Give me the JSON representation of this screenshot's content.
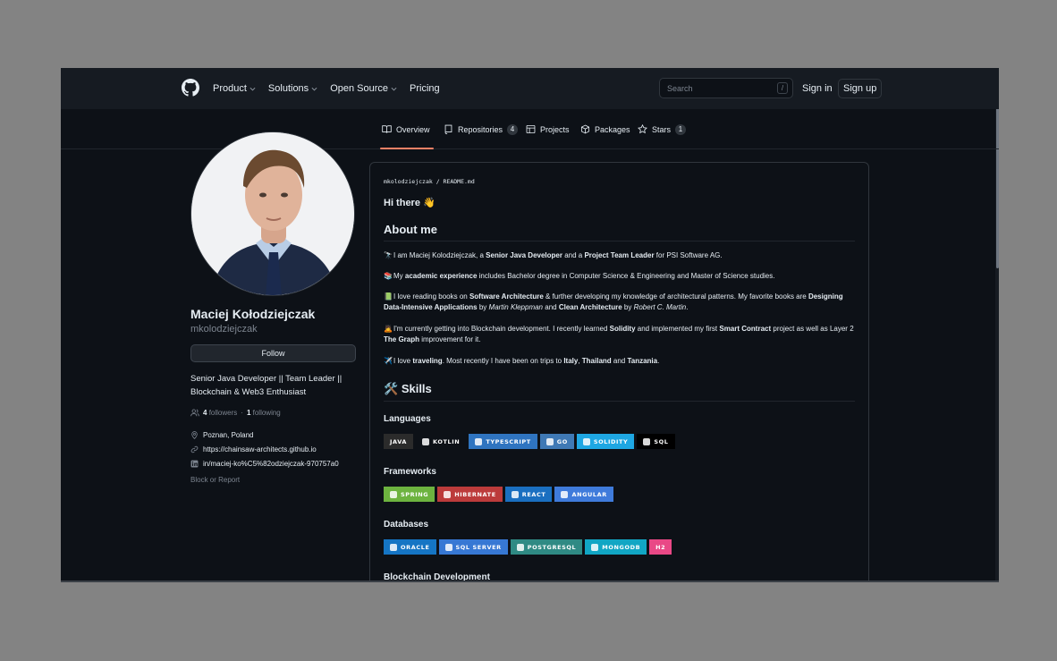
{
  "header": {
    "nav": [
      {
        "label": "Product",
        "has_caret": true
      },
      {
        "label": "Solutions",
        "has_caret": true
      },
      {
        "label": "Open Source",
        "has_caret": true
      },
      {
        "label": "Pricing",
        "has_caret": false
      }
    ],
    "search_placeholder": "Search",
    "search_shortcut": "/",
    "sign_in": "Sign in",
    "sign_up": "Sign up"
  },
  "tabs": [
    {
      "label": "Overview",
      "icon": "book-icon",
      "count": null,
      "active": true
    },
    {
      "label": "Repositories",
      "icon": "repo-icon",
      "count": "4",
      "active": false
    },
    {
      "label": "Projects",
      "icon": "table-icon",
      "count": null,
      "active": false
    },
    {
      "label": "Packages",
      "icon": "package-icon",
      "count": null,
      "active": false
    },
    {
      "label": "Stars",
      "icon": "star-icon",
      "count": "1",
      "active": false
    }
  ],
  "profile": {
    "name": "Maciej Kołodziejczak",
    "username": "mkolodziejczak",
    "follow_label": "Follow",
    "bio": "Senior Java Developer || Team Leader || Blockchain & Web3 Enthusiast",
    "followers_count": "4",
    "followers_label": "followers",
    "separator": "·",
    "following_count": "1",
    "following_label": "following",
    "location": "Poznan, Poland",
    "website": "https://chainsaw-architects.github.io",
    "linkedin": "in/maciej-ko%C5%82odziejczak-970757a0",
    "block_report": "Block or Report"
  },
  "readme": {
    "path": "mkolodziejczak / README.md",
    "greeting": "Hi there",
    "greeting_emoji": "👋",
    "about_heading": "About me",
    "paragraphs": {
      "p1": {
        "emoji": "🔭",
        "a": "I am Maciej Kolodziejczak, a ",
        "b1": "Senior Java Developer",
        "c": " and a ",
        "b2": "Project Team Leader",
        "d": " for PSI Software AG."
      },
      "p2": {
        "emoji": "📚",
        "a": "My ",
        "b1": "academic experience",
        "c": " includes Bachelor degree in Computer Science & Engineering and Master of Science studies."
      },
      "p3": {
        "emoji": "📗",
        "a": "I love reading books on ",
        "b1": "Software Architecture",
        "c": " & further developing my knowledge of architectural patterns. My favorite books are ",
        "b2": "Designing Data-Intensive Applications",
        "d": " by ",
        "i1": "Martin Kleppman",
        "e": " and ",
        "b3": "Clean Architecture",
        "f": " by ",
        "i2": "Robert C. Martin",
        "g": "."
      },
      "p4": {
        "emoji": "🙇",
        "a": "I'm currently getting into Blockchain development. I recently learned ",
        "b1": "Solidity",
        "c": " and implemented my first ",
        "b2": "Smart Contract",
        "d": " project as well as Layer 2 ",
        "b3": "The Graph",
        "e": " improvement for it."
      },
      "p5": {
        "emoji": "✈️",
        "a": "I love ",
        "b1": "traveling",
        "c": ". Most recently I have been on trips to ",
        "b2": "Italy",
        "d": ", ",
        "b3": "Thailand",
        "e": " and ",
        "b4": "Tanzania",
        "f": "."
      }
    },
    "skills_heading": "Skills",
    "skills_emoji": "🛠️",
    "sections": [
      {
        "title": "Languages",
        "badges": [
          {
            "label": "JAVA",
            "color": "#2b2b2b"
          },
          {
            "label": "KOTLIN",
            "color": "#0d1117"
          },
          {
            "label": "TYPESCRIPT",
            "color": "#2f74c0"
          },
          {
            "label": "GO",
            "color": "#3f79b5"
          },
          {
            "label": "SOLIDITY",
            "color": "#1ea7e3"
          },
          {
            "label": "SQL",
            "color": "#000000"
          }
        ]
      },
      {
        "title": "Frameworks",
        "badges": [
          {
            "label": "SPRING",
            "color": "#6db33f"
          },
          {
            "label": "HIBERNATE",
            "color": "#bc3b3b"
          },
          {
            "label": "REACT",
            "color": "#1a6fc0"
          },
          {
            "label": "ANGULAR",
            "color": "#3f7bdb"
          }
        ]
      },
      {
        "title": "Databases",
        "badges": [
          {
            "label": "ORACLE",
            "color": "#1575c4"
          },
          {
            "label": "SQL SERVER",
            "color": "#3778d4"
          },
          {
            "label": "POSTGRESQL",
            "color": "#2f8a84"
          },
          {
            "label": "MONGODB",
            "color": "#11a6c4"
          },
          {
            "label": "H2",
            "color": "#e94886"
          }
        ]
      }
    ],
    "next_section": "Blockchain Development"
  }
}
